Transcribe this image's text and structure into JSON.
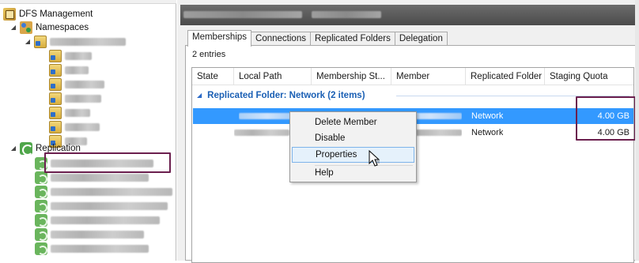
{
  "tree": {
    "root_label": "DFS Management",
    "namespaces_label": "Namespaces",
    "replication_label": "Replication"
  },
  "tabs": [
    "Memberships",
    "Connections",
    "Replicated Folders",
    "Delegation"
  ],
  "entries_count": "2 entries",
  "columns": [
    "State",
    "Local Path",
    "Membership St...",
    "Member",
    "Replicated Folder",
    "Staging Quota"
  ],
  "group_header": "Replicated Folder: Network (2 items)",
  "rows": [
    {
      "replicated_folder": "Network",
      "staging_quota": "4.00 GB"
    },
    {
      "replicated_folder": "Network",
      "staging_quota": "4.00 GB"
    }
  ],
  "context_menu": {
    "items": [
      "Delete Member",
      "Disable",
      "Properties",
      "Help"
    ]
  },
  "colors": {
    "selection": "#3399ff",
    "group_header_text": "#1a5fb4",
    "annotation_box": "#6b1f4e"
  }
}
